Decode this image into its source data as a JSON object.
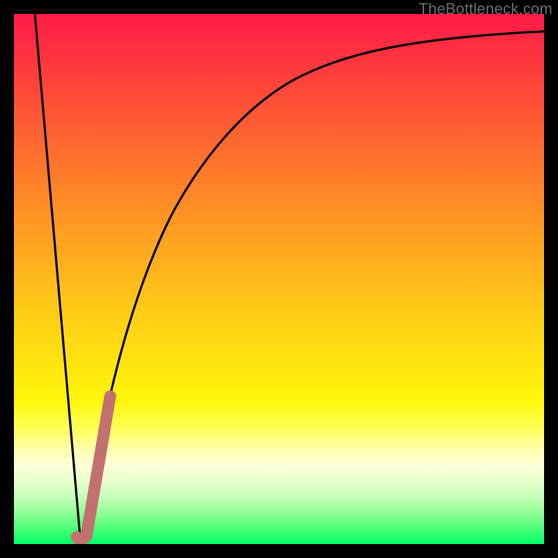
{
  "watermark": {
    "text": "TheBottleneck.com"
  },
  "chart_data": {
    "type": "line",
    "title": "",
    "xlabel": "",
    "ylabel": "",
    "xlim": [
      0,
      100
    ],
    "ylim": [
      0,
      100
    ],
    "grid": false,
    "legend": false,
    "series": [
      {
        "name": "bottleneck-curve",
        "x": [
          0,
          2,
          4,
          6,
          8,
          10,
          11,
          12,
          13,
          14,
          16,
          18,
          20,
          22,
          25,
          28,
          32,
          36,
          40,
          45,
          50,
          55,
          60,
          65,
          70,
          75,
          80,
          85,
          90,
          95,
          100
        ],
        "values": [
          100,
          82,
          64,
          46,
          28,
          10,
          4,
          0,
          6,
          14,
          26,
          36,
          44,
          50,
          57,
          62,
          68,
          72,
          76,
          80,
          83,
          85.5,
          87.5,
          89,
          90.3,
          91.3,
          92.1,
          92.8,
          93.3,
          93.7,
          94
        ]
      },
      {
        "name": "highlight-segment",
        "x": [
          11,
          12,
          13,
          14,
          15,
          16
        ],
        "values": [
          3,
          0,
          6,
          14,
          20,
          26
        ]
      }
    ],
    "annotations": [],
    "colors": {
      "curve": "#000000",
      "highlight": "#c37070",
      "gradient_top": "#ff1a47",
      "gradient_mid": "#ffe20f",
      "gradient_bottom": "#00ff66",
      "frame": "#000000"
    }
  }
}
